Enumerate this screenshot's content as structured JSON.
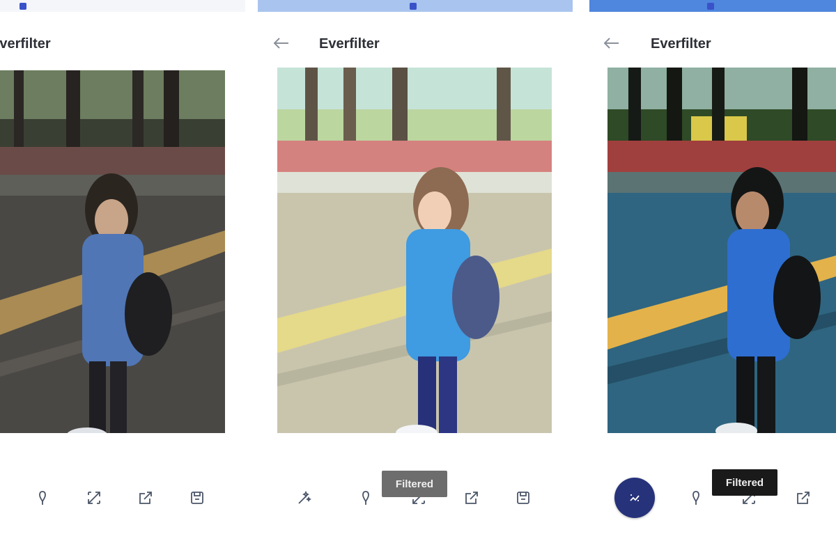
{
  "app": {
    "title": "Everfilter"
  },
  "panels": [
    {
      "id": "original",
      "title": "Everfilter",
      "filter": "original"
    },
    {
      "id": "filtered-light",
      "title": "Everfilter",
      "filter": "pastel",
      "tooltip": "Filtered"
    },
    {
      "id": "filtered-dark",
      "title": "Everfilter",
      "filter": "teal",
      "tooltip": "Filtered"
    }
  ],
  "icons": {
    "back": "back-arrow-icon",
    "sticker": "pin-icon",
    "crop": "crop-icon",
    "share": "share-icon",
    "save": "save-icon",
    "magic": "magic-wand-icon",
    "filter": "filter-fab-icon"
  },
  "colors": {
    "accent": "#26327a",
    "title": "#2c2f36",
    "icon": "#4a5568",
    "statusbar_light": "#a9c4ee",
    "statusbar_dark": "#4f86de"
  }
}
